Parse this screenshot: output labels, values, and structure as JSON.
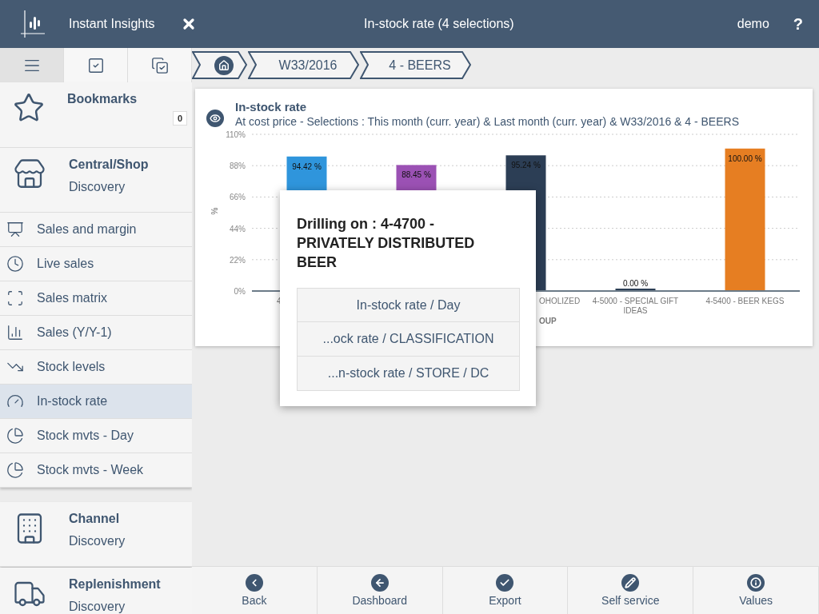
{
  "header": {
    "app_name": "Instant Insights",
    "title": "In-stock rate (4 selections)",
    "user": "demo",
    "help": "?"
  },
  "sidebar": {
    "tabs": [
      {
        "selected": true
      },
      {
        "selected": false
      },
      {
        "selected": false
      }
    ],
    "bookmarks": {
      "title": "Bookmarks",
      "count": "0"
    },
    "groups": [
      {
        "title": "Central/Shop",
        "subtitle": "Discovery",
        "items": [
          {
            "label": "Sales and margin",
            "selected": false
          },
          {
            "label": "Live sales",
            "selected": false
          },
          {
            "label": "Sales matrix",
            "selected": false
          },
          {
            "label": "Sales (Y/Y-1)",
            "selected": false
          },
          {
            "label": "Stock levels",
            "selected": false
          },
          {
            "label": "In-stock rate",
            "selected": true
          },
          {
            "label": "Stock mvts - Day",
            "selected": false
          },
          {
            "label": "Stock mvts - Week",
            "selected": false
          }
        ]
      },
      {
        "title": "Channel",
        "subtitle": "Discovery"
      },
      {
        "title": "Replenishment",
        "subtitle": "Discovery"
      }
    ]
  },
  "breadcrumb": [
    "W33/2016",
    "4 - BEERS"
  ],
  "chart_card": {
    "title": "In-stock rate",
    "subtitle": "At cost price - Selections : This month (curr. year) & Last month (curr. year) & W33/2016 & 4 - BEERS",
    "chart_data": {
      "type": "bar",
      "ylabel": "%",
      "xlabel": "OUP",
      "categories": [
        "4",
        null,
        "OHOLIZED",
        "4-5000 - SPECIAL GIFT IDEAS",
        "4-5400 - BEER KEGS"
      ],
      "values": [
        94.42,
        88.45,
        95.24,
        0,
        100
      ],
      "value_labels": [
        "94.42 %",
        "88.45 %",
        "95.24 %",
        "0.00 %",
        "100.00 %"
      ],
      "grid": true,
      "ylim": [
        0,
        110
      ],
      "yticks": [
        {
          "value": 0,
          "label": "0%"
        },
        {
          "value": 22,
          "label": "22%"
        },
        {
          "value": 44,
          "label": "44%"
        },
        {
          "value": 66,
          "label": "66%"
        },
        {
          "value": 88,
          "label": "88%"
        },
        {
          "value": 110,
          "label": "110%"
        }
      ]
    }
  },
  "popup": {
    "title": "Drilling on : 4-4700 - PRIVATELY DISTRIBUTED BEER",
    "options": [
      "In-stock rate / Day",
      "...ock rate / CLASSIFICATION",
      "...n-stock rate / STORE / DC"
    ]
  },
  "footer": [
    "Back",
    "Dashboard",
    "Export",
    "Self service",
    "Values"
  ]
}
